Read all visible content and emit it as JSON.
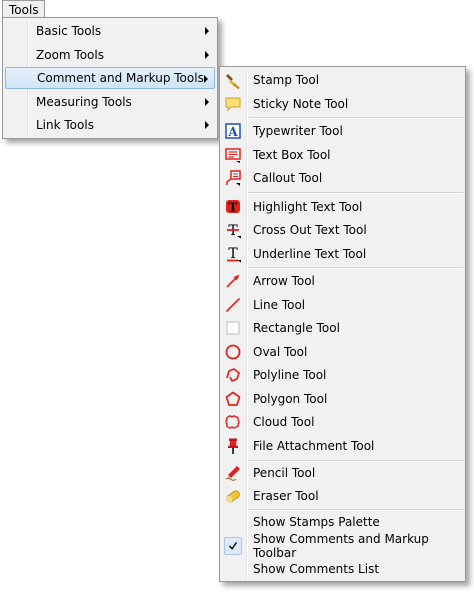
{
  "menubar": {
    "tools_label": "Tools"
  },
  "tools_menu": {
    "items": [
      {
        "label": "Basic Tools"
      },
      {
        "label": "Zoom Tools"
      },
      {
        "label": "Comment and Markup Tools"
      },
      {
        "label": "Measuring Tools"
      },
      {
        "label": "Link Tools"
      }
    ]
  },
  "comment_menu": {
    "items": [
      {
        "label": "Stamp Tool",
        "icon": "stamp-icon"
      },
      {
        "label": "Sticky Note Tool",
        "icon": "sticky-note-icon"
      },
      {
        "label": "Typewriter Tool",
        "icon": "typewriter-icon"
      },
      {
        "label": "Text Box Tool",
        "icon": "text-box-icon"
      },
      {
        "label": "Callout Tool",
        "icon": "callout-icon"
      },
      {
        "label": "Highlight Text Tool",
        "icon": "highlight-text-icon"
      },
      {
        "label": "Cross Out Text Tool",
        "icon": "cross-out-text-icon"
      },
      {
        "label": "Underline Text Tool",
        "icon": "underline-text-icon"
      },
      {
        "label": "Arrow Tool",
        "icon": "arrow-icon"
      },
      {
        "label": "Line Tool",
        "icon": "line-icon"
      },
      {
        "label": "Rectangle Tool",
        "icon": "rectangle-icon"
      },
      {
        "label": "Oval Tool",
        "icon": "oval-icon"
      },
      {
        "label": "Polyline Tool",
        "icon": "polyline-icon"
      },
      {
        "label": "Polygon Tool",
        "icon": "polygon-icon"
      },
      {
        "label": "Cloud Tool",
        "icon": "cloud-icon"
      },
      {
        "label": "File Attachment Tool",
        "icon": "pushpin-icon"
      },
      {
        "label": "Pencil Tool",
        "icon": "pencil-icon"
      },
      {
        "label": "Eraser Tool",
        "icon": "eraser-icon"
      },
      {
        "label": "Show Stamps Palette"
      },
      {
        "label": "Show Comments and Markup Toolbar",
        "checked": true,
        "icon": "checkmark-icon"
      },
      {
        "label": "Show Comments List"
      }
    ]
  },
  "colors": {
    "highlight": "#cfe4f7",
    "menu_bg": "#f1f1f1",
    "icon_red": "#e0211c",
    "icon_blue": "#1f4fb8"
  }
}
